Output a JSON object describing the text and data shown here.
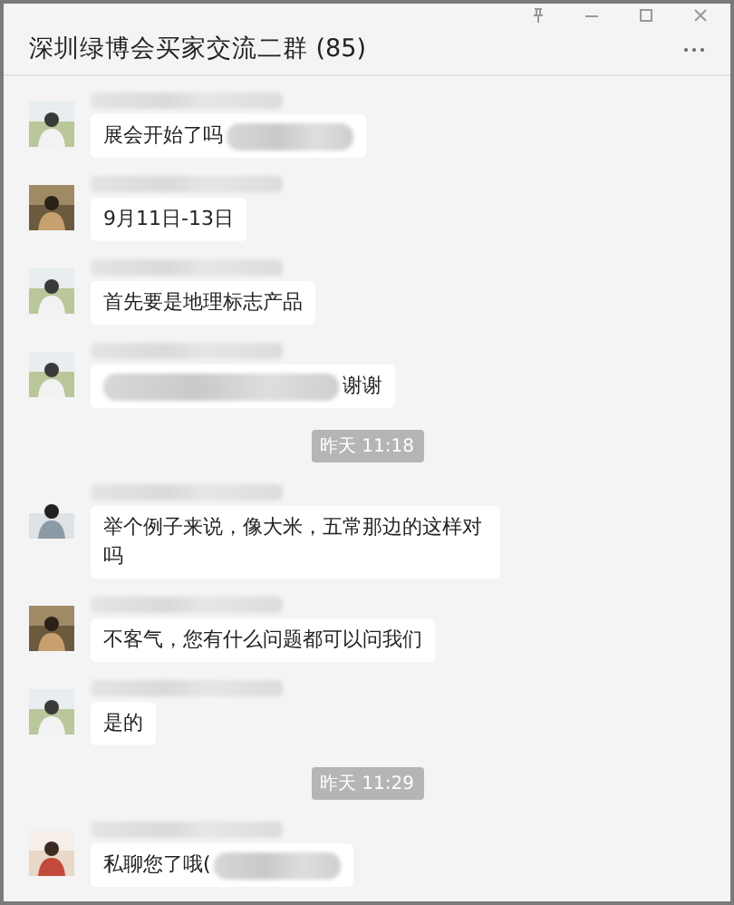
{
  "window": {
    "title": "深圳绿博会买家交流二群 (85)"
  },
  "messages": [
    {
      "kind": "message",
      "text": "展会开始了吗",
      "redacted_before": false,
      "redacted_after": true
    },
    {
      "kind": "message",
      "text": "9月11日-13日",
      "redacted_before": false,
      "redacted_after": false
    },
    {
      "kind": "message",
      "text": "首先要是地理标志产品",
      "redacted_before": false,
      "redacted_after": false
    },
    {
      "kind": "message",
      "text": "谢谢",
      "redacted_before": true,
      "redacted_after": false
    },
    {
      "kind": "time",
      "text": "昨天 11:18"
    },
    {
      "kind": "message",
      "text": "举个例子来说，像大米，五常那边的这样对吗",
      "redacted_before": false,
      "redacted_after": false
    },
    {
      "kind": "message",
      "text": "不客气，您有什么问题都可以问我们",
      "redacted_before": false,
      "redacted_after": false
    },
    {
      "kind": "message",
      "text": "是的",
      "redacted_before": false,
      "redacted_after": false
    },
    {
      "kind": "time",
      "text": "昨天 11:29"
    },
    {
      "kind": "message",
      "text": "私聊您了哦(",
      "redacted_before": false,
      "redacted_after": true
    }
  ]
}
